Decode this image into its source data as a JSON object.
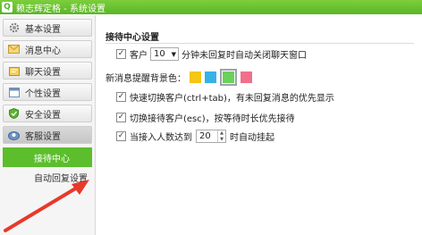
{
  "window": {
    "title": "赖志辉定格 - 系统设置",
    "logo_glyph": "Q"
  },
  "sidebar": {
    "items": [
      {
        "label": "基本设置",
        "icon": "gear-icon"
      },
      {
        "label": "消息中心",
        "icon": "envelope-icon"
      },
      {
        "label": "聊天设置",
        "icon": "chat-folder-icon"
      },
      {
        "label": "个性设置",
        "icon": "window-icon"
      },
      {
        "label": "安全设置",
        "icon": "shield-icon"
      },
      {
        "label": "客服设置",
        "icon": "headset-icon"
      }
    ],
    "sub_items": [
      {
        "label": "接待中心"
      },
      {
        "label": "自动回复设置"
      }
    ]
  },
  "main": {
    "section_title": "接待中心设置",
    "row1": {
      "checked_mark": "✓",
      "prefix": "客户",
      "select_value": "10",
      "suffix": "分钟未回复时自动关闭聊天窗口"
    },
    "row2": {
      "label": "新消息提醒背景色：",
      "colors": [
        "#f5c518",
        "#36b2e8",
        "#6ad15a",
        "#f26f8a"
      ],
      "selected_color": "#6ad15a"
    },
    "row3": {
      "checked_mark": "✓",
      "text": "快速切换客户(ctrl+tab)，有未回复消息的优先显示"
    },
    "row4": {
      "checked_mark": "✓",
      "text": "切换接待客户(esc)，按等待时长优先接待"
    },
    "row5": {
      "checked_mark": "✓",
      "prefix": "当接入人数达到",
      "spin_value": "20",
      "suffix": "时自动挂起"
    }
  },
  "annotation": {
    "arrow_color": "#e8392b"
  }
}
